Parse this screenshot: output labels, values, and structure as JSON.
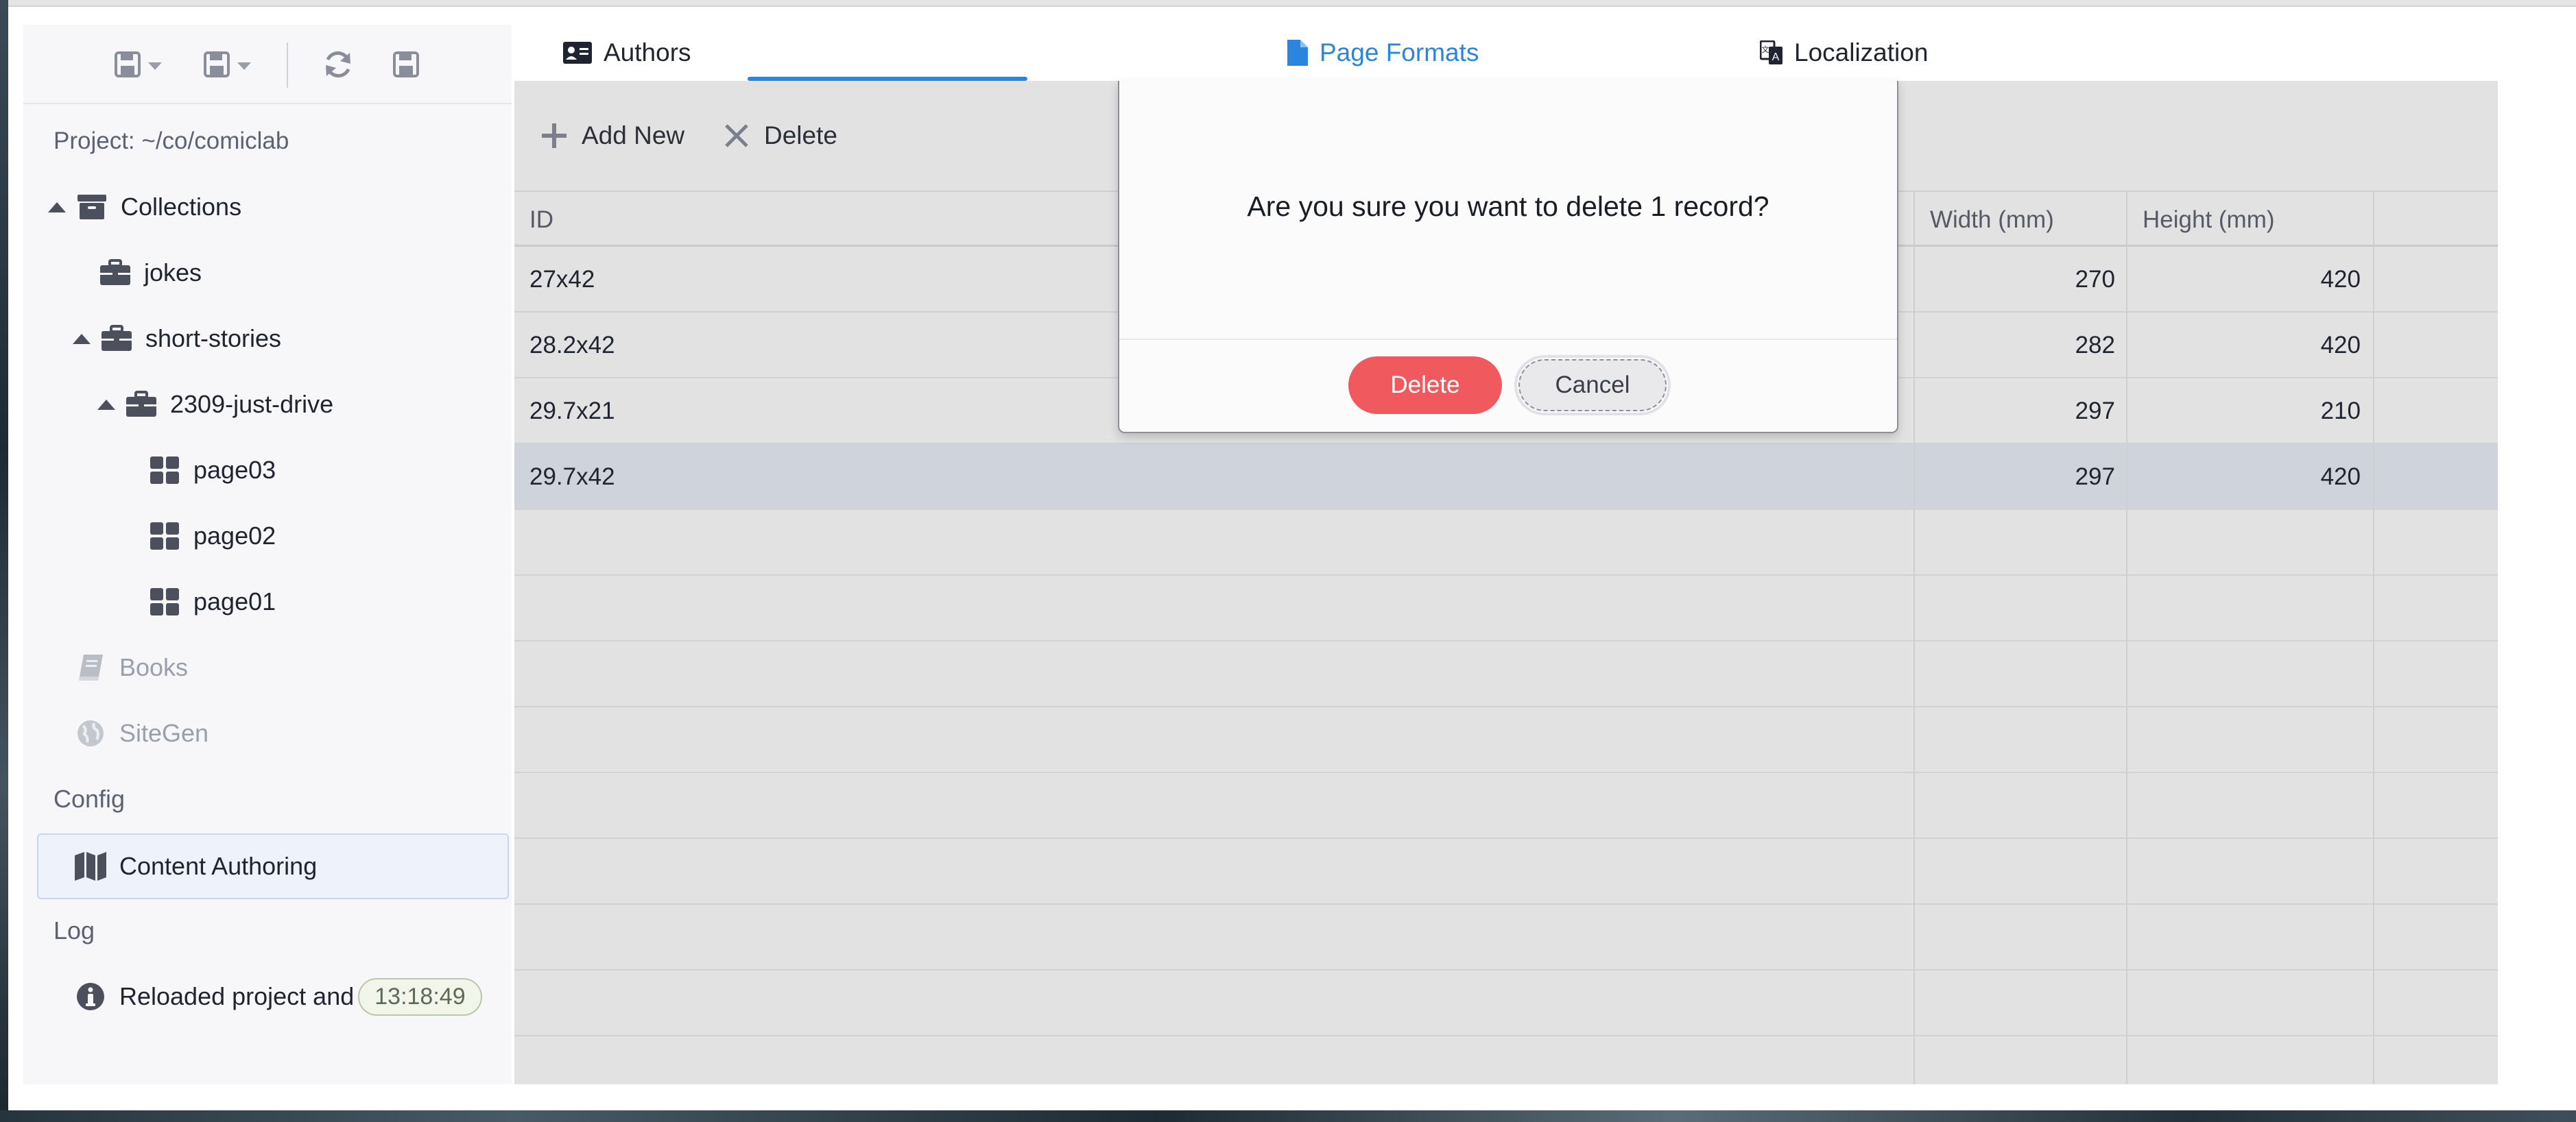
{
  "sidebar": {
    "toolbar": [
      {
        "name": "save-menu-icon"
      },
      {
        "name": "save-as-menu-icon"
      },
      {
        "name": "refresh-icon"
      },
      {
        "name": "save-icon"
      }
    ],
    "project_label": "Project: ~/co/comiclab",
    "tree": {
      "collections": "Collections",
      "jokes": "jokes",
      "short_stories": "short-stories",
      "just_drive": "2309-just-drive",
      "page03": "page03",
      "page02": "page02",
      "page01": "page01",
      "books": "Books",
      "sitegen": "SiteGen"
    },
    "config_label": "Config",
    "content_authoring": "Content Authoring",
    "log_label": "Log",
    "log_entry": {
      "text": "Reloaded project and",
      "time": "13:18:49"
    }
  },
  "tabs": [
    {
      "label": "Authors",
      "icon": "id-card-icon"
    },
    {
      "label": "Page Formats",
      "icon": "file-icon",
      "active": true
    },
    {
      "label": "Localization",
      "icon": "language-icon"
    }
  ],
  "actions": {
    "add_new": "Add New",
    "delete": "Delete"
  },
  "grid": {
    "columns": [
      "ID",
      "Width (mm)",
      "Height (mm)"
    ],
    "rows": [
      {
        "id": "27x42",
        "width": "270",
        "height": "420"
      },
      {
        "id": "28.2x42",
        "width": "282",
        "height": "420"
      },
      {
        "id": "29.7x21",
        "width": "297",
        "height": "210"
      },
      {
        "id": "29.7x42",
        "width": "297",
        "height": "420",
        "selected": true
      }
    ]
  },
  "dialog": {
    "message": "Are you sure you want to delete 1 record?",
    "confirm_label": "Delete",
    "cancel_label": "Cancel"
  },
  "colors": {
    "accent": "#2a86dc",
    "danger": "#f05a5f",
    "selected_row": "#cfd3db"
  }
}
